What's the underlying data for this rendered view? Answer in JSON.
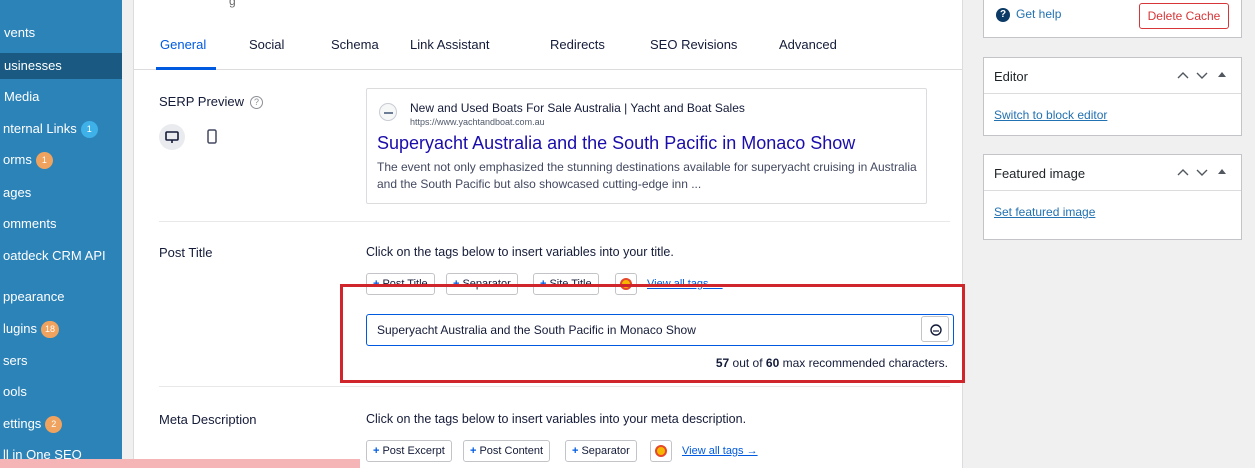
{
  "sidebar": {
    "items": [
      {
        "label": "vents",
        "badge": ""
      },
      {
        "label": "usinesses",
        "badge": ""
      },
      {
        "label": "Media",
        "badge": ""
      },
      {
        "label": "nternal Links",
        "badge": "1"
      },
      {
        "label": "orms",
        "badge": "1"
      },
      {
        "label": "ages",
        "badge": ""
      },
      {
        "label": "omments",
        "badge": ""
      },
      {
        "label": "oatdeck CRM API",
        "badge": ""
      },
      {
        "label": "ppearance",
        "badge": ""
      },
      {
        "label": "lugins",
        "badge": "18"
      },
      {
        "label": "sers",
        "badge": ""
      },
      {
        "label": "ools",
        "badge": ""
      },
      {
        "label": "ettings",
        "badge": "2"
      },
      {
        "label": "ll in One SEO",
        "badge": ""
      }
    ]
  },
  "panel": {
    "top_text": "g",
    "tabs": [
      "General",
      "Social",
      "Schema",
      "Link Assistant",
      "Redirects",
      "SEO Revisions",
      "Advanced"
    ],
    "active_tab": "General"
  },
  "serp": {
    "label": "SERP Preview",
    "hint": "?",
    "site_name": "New and Used Boats For Sale Australia | Yacht and Boat Sales",
    "url": "https://www.yachtandboat.com.au",
    "title": "Superyacht Australia and the South Pacific in Monaco Show",
    "description": "The event not only emphasized the stunning destinations available for superyacht cruising in Australia and the South Pacific but also showcased cutting-edge inn ..."
  },
  "post_title": {
    "label": "Post Title",
    "help": "Click on the tags below to insert variables into your title.",
    "tags": [
      "Post Title",
      "Separator",
      "Site Title"
    ],
    "view_all": "View all tags →",
    "value": "Superyacht Australia and the South Pacific in Monaco Show",
    "count": "57",
    "count_mid": " out of ",
    "max": "60",
    "count_suffix": " max recommended characters."
  },
  "meta": {
    "label": "Meta Description",
    "help": "Click on the tags below to insert variables into your meta description.",
    "tags": [
      "Post Excerpt",
      "Post Content",
      "Separator"
    ],
    "view_all": "View all tags →"
  },
  "right": {
    "get_help": "Get help",
    "delete_cache": "Delete Cache",
    "editor_title": "Editor",
    "switch_editor": "Switch to block editor",
    "featured_title": "Featured image",
    "set_featured": "Set featured image"
  },
  "bottom_strip_text": "",
  "colors": {
    "sidebar": "#2c83b8",
    "accent": "#005ae0",
    "highlight": "#d0252b",
    "serp_title": "#1a0dab"
  }
}
